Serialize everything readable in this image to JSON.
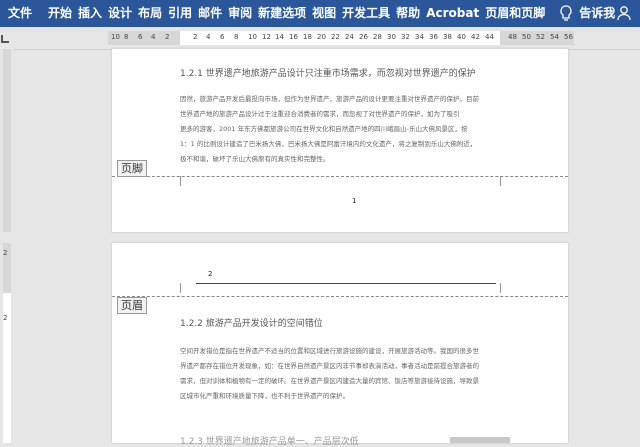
{
  "ribbon": {
    "tabs": [
      "文件",
      "开始",
      "插入",
      "设计",
      "布局",
      "引用",
      "邮件",
      "审阅",
      "新建选项",
      "视图",
      "开发工具",
      "帮助",
      "Acrobat",
      "页眉和页脚"
    ],
    "tell_me": "告诉我",
    "bg": "#2b579a"
  },
  "ruler": {
    "ticks": [
      "10",
      "8",
      "6",
      "4",
      "2",
      "2",
      "4",
      "6",
      "8",
      "10",
      "12",
      "14",
      "16",
      "18",
      "20",
      "22",
      "24",
      "26",
      "28",
      "30",
      "32",
      "34",
      "36",
      "38",
      "40",
      "42",
      "44",
      "48",
      "50",
      "52",
      "54",
      "56"
    ]
  },
  "vruler": {
    "ticks": [
      "2",
      "2"
    ]
  },
  "page1": {
    "heading": "1.2.1    世界遗产地旅游产品设计只注重市场需求，而忽视对世界遗产的保护",
    "paragraph_lines": [
      "因然，旅游产品开发后最投向市场，但作为世界遗产，旅游产品的设计更要注重对世界遗产的保护。目前",
      "世界遗产地的旅游产品设计过于注重迎合消费者的需求，而忽视了对世界遗产的保护，如为了吸引",
      "更多的游客，2001 年东方佛都旅游公司在世界文化和自然遗产地的四川峨眉山-乐山大佛风景区，按",
      "1：1 的比例设计建造了巴米扬大佛，巴米扬大佛是阿富汗境内的文化遗产，将之复制到乐山大佛附近，",
      "极不和谐，破坏了乐山大佛原有的真实性和完整性。"
    ],
    "footer_label": "页脚",
    "page_number": "1"
  },
  "page2": {
    "header_label": "页眉",
    "header_number": "2",
    "heading": "1.2.2    旅游产品开发设计的空间错位",
    "paragraph_lines": [
      "空间开发错位是指在世界遗产不适当的位置和区域进行旅游设施的建设，开展旅游活动等。我国的很多世",
      "界遗产都存在错位开发现象，如：在世界自然遗产景区内非节事却表演活动，事者活动是前提合旅游者的",
      "需求，但对训体和植物有一定的破环。在世界遗产景区内建造大量的宾馆、饭店等旅游接待设施，导致景",
      "区城市化严重和环境质量下降，也不利于世界遗产的保护。"
    ],
    "next_heading": "1.2.3    世界遗产地旅游产品单一、产品层次低"
  }
}
